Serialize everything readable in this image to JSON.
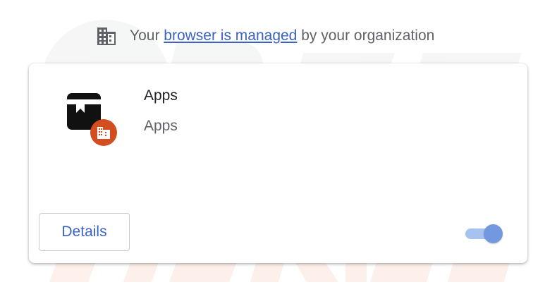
{
  "banner": {
    "prefix": "Your ",
    "link": "browser is managed",
    "suffix": " by your organization",
    "icon": "building-icon"
  },
  "extension": {
    "title": "Apps",
    "description": "Apps",
    "icon": "apps-extension-icon",
    "badge_icon": "enterprise-building-badge-icon",
    "enabled": true
  },
  "buttons": {
    "details_label": "Details"
  },
  "colors": {
    "accent": "#3b63c6",
    "toggle_track": "#a8c2ef",
    "toggle_knob": "#7298e0",
    "badge": "#d24d1f"
  }
}
